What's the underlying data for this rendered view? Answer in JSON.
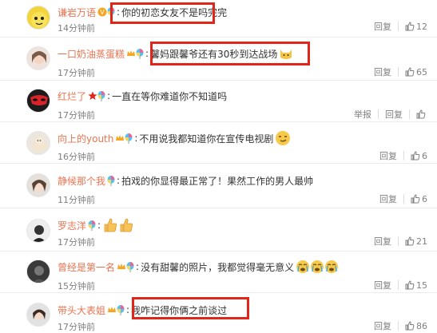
{
  "actions": {
    "reply": "回复",
    "report": "举报"
  },
  "comments": [
    {
      "user": "谦岩万语",
      "text": "你的初恋女友不是吗完完",
      "time": "14分钟前",
      "likes": "12"
    },
    {
      "user": "一口奶油蒸蛋糕",
      "text": "馨妈跟馨爷还有30秒到达战场",
      "time": "17分钟前",
      "likes": "65"
    },
    {
      "user": "红烂了",
      "text": "一直在等你难道你不知道吗",
      "time": "17分钟前",
      "likes": ""
    },
    {
      "user": "向上的youth",
      "text": "不用说我都知道你在宣传电视剧",
      "time": "16分钟前",
      "likes": "6"
    },
    {
      "user": "静候那个我",
      "text": "拍戏的你显得最正常了！果然工作的男人最帅",
      "time": "11分钟前",
      "likes": "6"
    },
    {
      "user": "罗志洋",
      "text": "",
      "time": "17分钟前",
      "likes": "21"
    },
    {
      "user": "曾经是第一名",
      "text": "没有甜馨的照片，我都觉得毫无意义",
      "time": "15分钟前",
      "likes": "15"
    },
    {
      "user": "带头大表姐",
      "text": "我咋记得你俩之前谈过",
      "time": "17分钟前",
      "likes": "86"
    }
  ]
}
